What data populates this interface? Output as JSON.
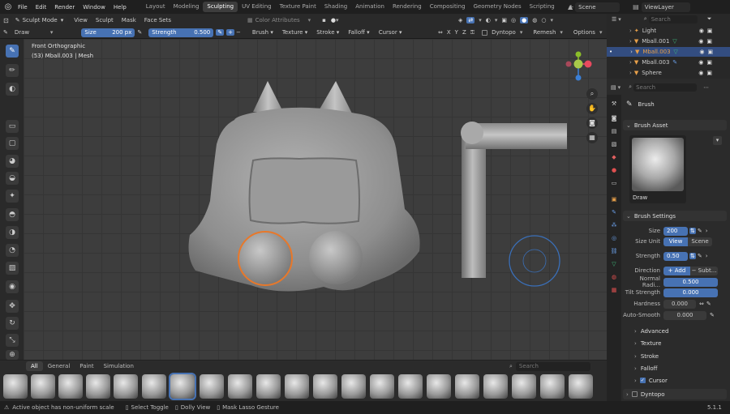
{
  "topbar": {
    "menus": [
      "File",
      "Edit",
      "Render",
      "Window",
      "Help"
    ],
    "workspaces": [
      "Layout",
      "Modeling",
      "Sculpting",
      "UV Editing",
      "Texture Paint",
      "Shading",
      "Animation",
      "Rendering",
      "Compositing",
      "Geometry Nodes",
      "Scripting"
    ],
    "active_workspace": "Sculpting",
    "scene": "Scene",
    "viewlayer": "ViewLayer"
  },
  "header": {
    "mode": "Sculpt Mode",
    "menus": [
      "View",
      "Sculpt",
      "Mask",
      "Face Sets"
    ],
    "color_attributes": "Color Attributes"
  },
  "toolsettings": {
    "brush_name": "Draw",
    "size_label": "Size",
    "size_value": "200 px",
    "strength_label": "Strength",
    "strength_value": "0.500",
    "dropdowns": [
      "Brush",
      "Texture",
      "Stroke",
      "Falloff",
      "Cursor"
    ],
    "axes": [
      "X",
      "Y",
      "Z"
    ],
    "dyntopo": "Dyntopo",
    "remesh": "Remesh",
    "options": "Options"
  },
  "viewport": {
    "view_name": "Front Orthographic",
    "object_info": "(53) Mball.003 | Mesh"
  },
  "shelf": {
    "tabs": [
      "All",
      "General",
      "Paint",
      "Simulation"
    ],
    "search_placeholder": "Search"
  },
  "statusbar": {
    "message": "Active object has non-uniform scale",
    "hint1": "Select Toggle",
    "hint2": "Dolly View",
    "hint3": "Mask Lasso Gesture",
    "version": "5.1.1"
  },
  "outliner": {
    "search_placeholder": "Search",
    "items": [
      {
        "name": "Light",
        "selected": false
      },
      {
        "name": "Mball.001",
        "selected": false
      },
      {
        "name": "Mball.003",
        "selected": true
      },
      {
        "name": "Mball.003",
        "selected": false
      },
      {
        "name": "Sphere",
        "selected": false
      }
    ]
  },
  "properties": {
    "search_placeholder": "Search",
    "brush_title": "Brush",
    "brush_asset_header": "Brush Asset",
    "brush_asset_name": "Draw",
    "brush_settings_header": "Brush Settings",
    "size_label": "Size",
    "size_value": "200",
    "size_unit_label": "Size Unit",
    "size_unit_view": "View",
    "size_unit_scene": "Scene",
    "strength_label": "Strength",
    "strength_value": "0.50",
    "direction_label": "Direction",
    "direction_add": "Add",
    "direction_sub": "Subt...",
    "normal_radius_label": "Normal Radi...",
    "normal_radius_value": "0.500",
    "tilt_strength_label": "Tilt Strength",
    "tilt_strength_value": "0.000",
    "hardness_label": "Hardness",
    "hardness_value": "0.000",
    "auto_smooth_label": "Auto-Smooth",
    "auto_smooth_value": "0.000",
    "subsections": [
      "Advanced",
      "Texture",
      "Stroke",
      "Falloff",
      "Cursor"
    ],
    "dyntopo_label": "Dyntopo"
  },
  "colors": {
    "accent": "#4772b3",
    "selection_outline": "#e8782a",
    "cursor_circle": "#3a6fb8"
  }
}
